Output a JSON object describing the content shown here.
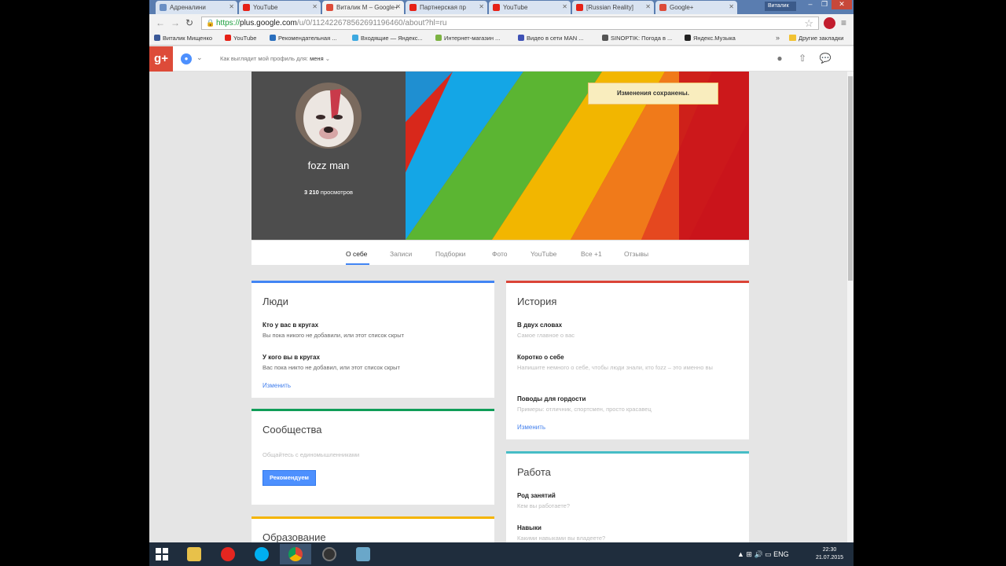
{
  "browser": {
    "tabs": [
      {
        "label": "Адреналини",
        "color": "#6a8fc4"
      },
      {
        "label": "YouTube",
        "color": "#e62117"
      },
      {
        "label": "Виталик М – Google+",
        "color": "#dd4b39"
      },
      {
        "label": "Партнерская пр",
        "color": "#e62117"
      },
      {
        "label": "YouTube",
        "color": "#e62117"
      },
      {
        "label": "[Russian Reality]",
        "color": "#e62117"
      },
      {
        "label": "Google+",
        "color": "#dd4b39"
      }
    ],
    "user_chip": "Виталик",
    "url_scheme": "https://",
    "url_host": "plus.google.com",
    "url_path": "/u/0/112422678562691196460/about?hl=ru",
    "bookmarks": [
      "Виталик Мищенко",
      "YouTube",
      "Рекомендательная ...",
      "Входящие — Яндекс...",
      "Интернет-магазин ...",
      "Видео в сети MAN ...",
      "SINOPTIK: Погода в ...",
      "Яндекс.Музыка"
    ],
    "bookmarks_more": "»",
    "bookmarks_other": "Другие закладки"
  },
  "gplus": {
    "logo": "g+",
    "view_as_label": "Как выглядит мой профиль для:",
    "view_as_value": "меня"
  },
  "profile": {
    "name": "fozz man",
    "views_count": "3 210",
    "views_label": "просмотров",
    "toast": "Изменения сохранены.",
    "tabs": [
      "О себе",
      "Записи",
      "Подборки",
      "Фото",
      "YouTube",
      "Все +1",
      "Отзывы"
    ]
  },
  "people": {
    "title": "Люди",
    "f1_title": "Кто у вас в кругах",
    "f1_value": "Вы пока никого не добавили, или этот список скрыт",
    "f2_title": "У кого вы в кругах",
    "f2_value": "Вас пока никто не добавил, или этот список скрыт",
    "edit": "Изменить"
  },
  "communities": {
    "title": "Сообщества",
    "subtitle": "Общайтесь с единомышленниками",
    "button": "Рекомендуем"
  },
  "education": {
    "title": "Образование"
  },
  "story": {
    "title": "История",
    "f1_title": "В двух словах",
    "f1_value": "Самое главное о вас",
    "f2_title": "Коротко о себе",
    "f2_value": "Напишите немного о себе, чтобы люди знали, кто fozz – это именно вы",
    "f3_title": "Поводы для гордости",
    "f3_value": "Примеры: отличник, спортсмен, просто красавец",
    "edit": "Изменить"
  },
  "work": {
    "title": "Работа",
    "f1_title": "Род занятий",
    "f1_value": "Кем вы работаете?",
    "f2_title": "Навыки",
    "f2_value": "Какими навыками вы владеете?"
  },
  "taskbar": {
    "lang": "ENG",
    "time": "22:30",
    "date": "21.07.2015"
  },
  "colors": {
    "gplus_red": "#dd4b39",
    "card_people": "#4285f4",
    "card_communities": "#0f9d58",
    "card_education": "#f4b400",
    "card_story": "#db4437",
    "card_work": "#46bdc6"
  }
}
